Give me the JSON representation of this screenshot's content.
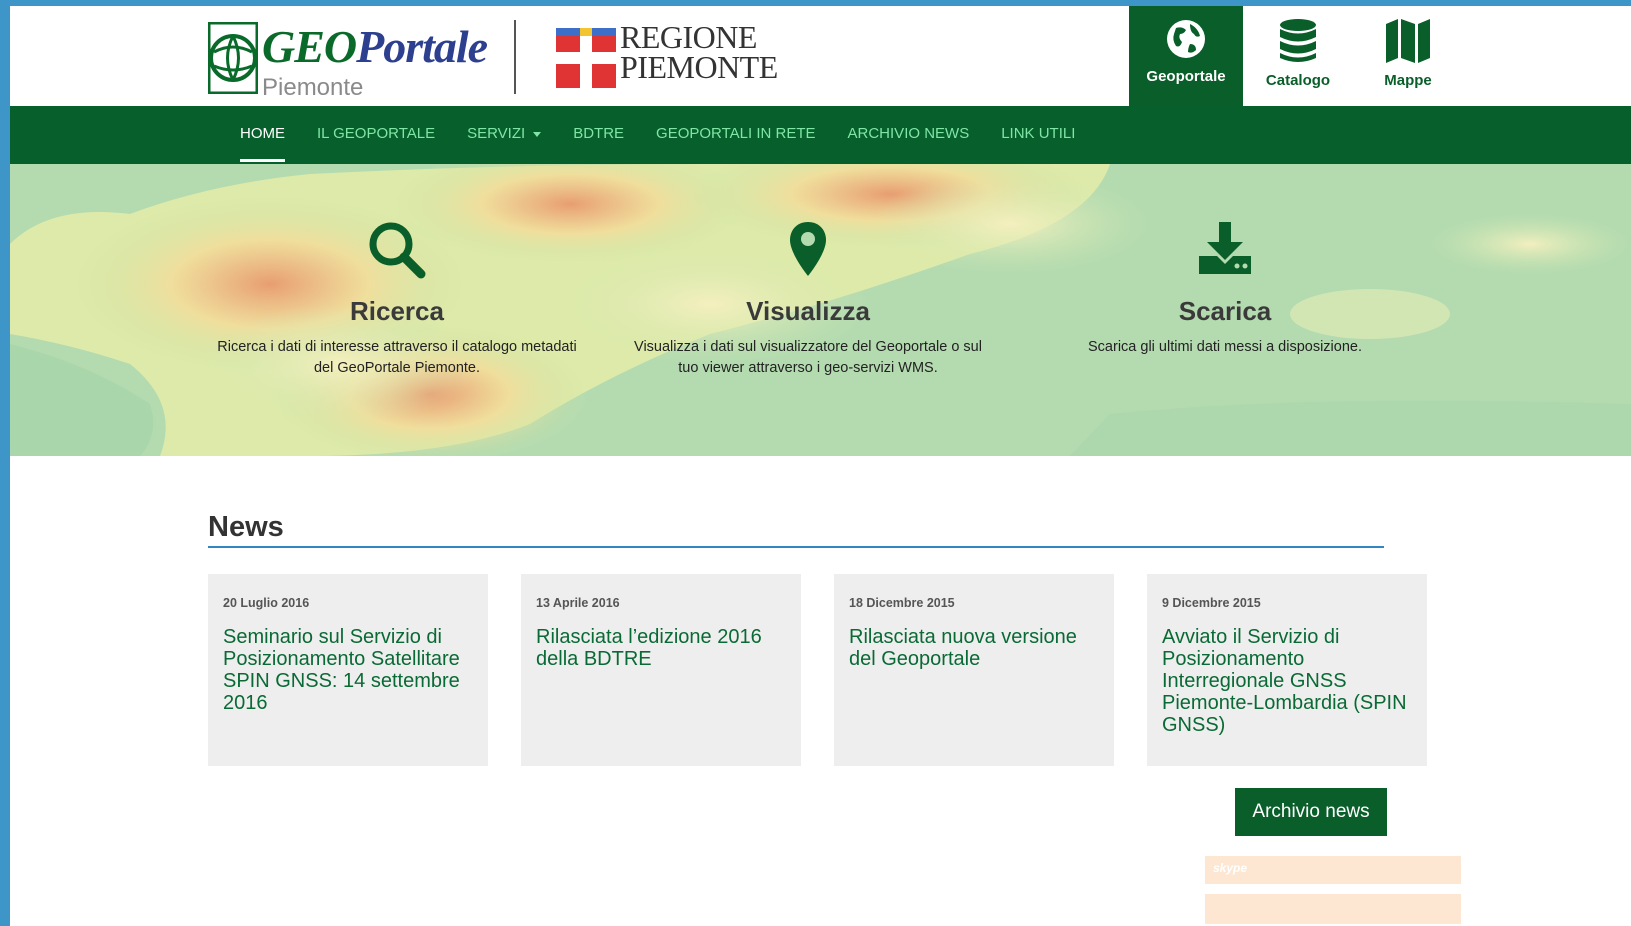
{
  "header": {
    "logo_geo_first": "GEO",
    "logo_geo_second": "Portale",
    "logo_geo_sub": "Piemonte",
    "logo_regione_line1": "REGIONE",
    "logo_regione_line2": "PIEMONTE",
    "topnav": [
      {
        "label": "Geoportale",
        "icon": "globe-icon",
        "active": true
      },
      {
        "label": "Catalogo",
        "icon": "database-icon",
        "active": false
      },
      {
        "label": "Mappe",
        "icon": "map-icon",
        "active": false
      }
    ]
  },
  "menu": [
    {
      "label": "HOME",
      "active": true
    },
    {
      "label": "IL GEOPORTALE"
    },
    {
      "label": "SERVIZI",
      "dropdown": true
    },
    {
      "label": "BDTRE"
    },
    {
      "label": "GEOPORTALI IN RETE"
    },
    {
      "label": "ARCHIVIO NEWS"
    },
    {
      "label": "LINK UTILI"
    }
  ],
  "features": [
    {
      "icon": "search-icon",
      "title": "Ricerca",
      "line1": "Ricerca i dati di interesse attraverso il catalogo metadati",
      "line2": "del GeoPortale Piemonte."
    },
    {
      "icon": "map-marker-icon",
      "title": "Visualizza",
      "line1": "Visualizza i dati sul visualizzatore del Geoportale o sul",
      "line2": "tuo viewer attraverso i geo-servizi WMS."
    },
    {
      "icon": "download-icon",
      "title": "Scarica",
      "line1": "Scarica gli ultimi dati messi a disposizione.",
      "line2": ""
    }
  ],
  "news": {
    "title": "News",
    "items": [
      {
        "date": "20 Luglio 2016",
        "title": "Seminario sul Servizio di Posizionamento Satellitare SPIN GNSS: 14 settembre 2016"
      },
      {
        "date": "13 Aprile 2016",
        "title": "Rilasciata l’edizione 2016 della BDTRE"
      },
      {
        "date": "18 Dicembre 2015",
        "title": "Rilasciata nuova versione del Geoportale"
      },
      {
        "date": "9 Dicembre 2015",
        "title": "Avviato il Servizio di Posizionamento Interregionale GNSS Piemonte-Lombardia (SPIN GNSS)"
      }
    ],
    "archive_button": "Archivio news"
  },
  "widgets": {
    "skype_label": "skype"
  },
  "colors": {
    "brand_green": "#075f2b",
    "menu_text": "#7fe6a5",
    "accent_blue": "#2f86c2",
    "frame_blue": "#3d95c8"
  }
}
